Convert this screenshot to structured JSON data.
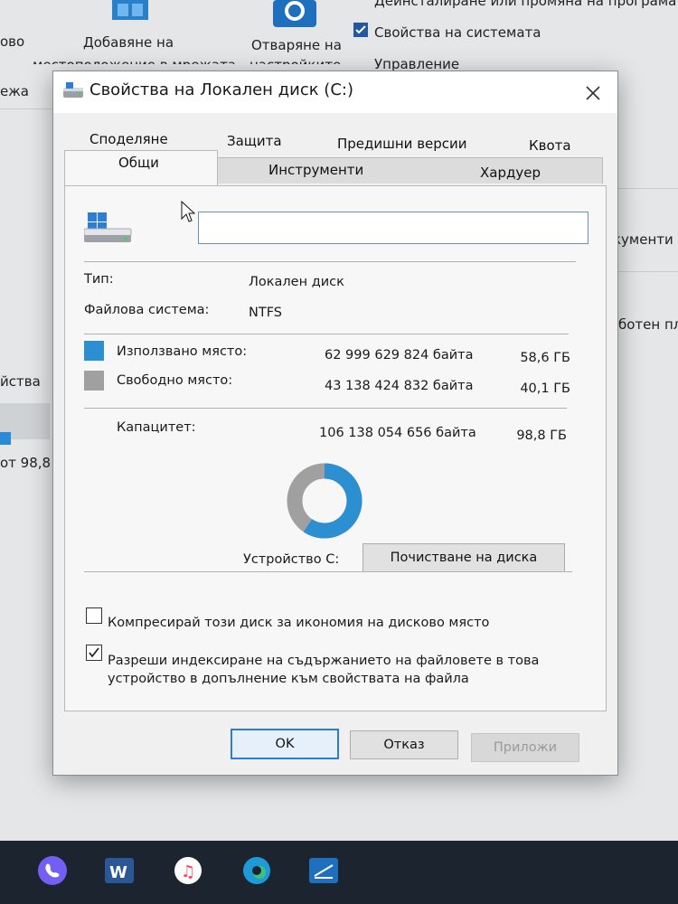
{
  "background": {
    "texts": [
      "ово",
      "Добавяне на",
      "местоположение в мрежата",
      "Отваряне на",
      "настройките",
      "Деинсталиране или промяна на програма",
      "Свойства на системата",
      "Управление",
      "ежа",
      "йства",
      "кументи",
      "ботен пл",
      "от 98,8"
    ]
  },
  "dialog": {
    "title": "Свойства на Локален диск (C:)",
    "tabs": {
      "row1": [
        "Споделяне",
        "Защита",
        "Предишни версии",
        "Квота"
      ],
      "row2": [
        "Общи",
        "Инструменти",
        "Хардуер"
      ],
      "active": "Общи"
    },
    "name_value": "",
    "type_label": "Тип:",
    "type_value": "Локален диск",
    "fs_label": "Файлова система:",
    "fs_value": "NTFS",
    "used": {
      "label": "Използвано място:",
      "bytes": "62 999 629 824 байта",
      "size": "58,6 ГБ",
      "color": "#2b8fd1"
    },
    "free": {
      "label": "Свободно място:",
      "bytes": "43 138 424 832 байта",
      "size": "40,1 ГБ",
      "color": "#a0a0a0"
    },
    "capacity": {
      "label": "Капацитет:",
      "bytes": "106 138 054 656 байта",
      "size": "98,8 ГБ"
    },
    "used_fraction": 0.594,
    "device_label": "Устройство C:",
    "cleanup_button": "Почистване на диска",
    "compress_label": "Компресирай този диск за икономия на дисково място",
    "compress_checked": false,
    "index_label": "Разреши индексиране на съдържанието на файловете в това устройство в допълнение към свойствата на файла",
    "index_checked": true,
    "buttons": {
      "ok": "OK",
      "cancel": "Отказ",
      "apply": "Приложи"
    }
  },
  "taskbar": {
    "apps": [
      "viber-icon",
      "word-icon",
      "itunes-icon",
      "edge-icon",
      "app-icon"
    ]
  }
}
